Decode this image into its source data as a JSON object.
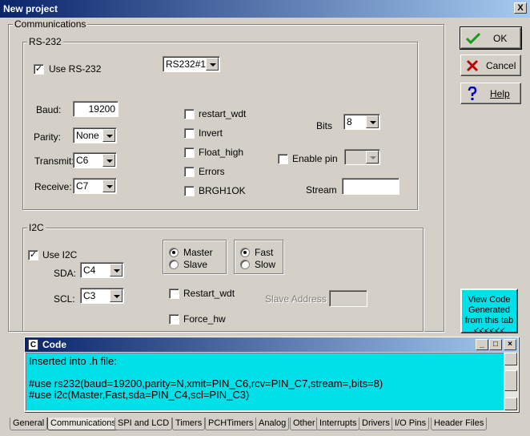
{
  "window": {
    "title": "New project",
    "close_glyph": "X"
  },
  "communications_group": {
    "label": "Communications"
  },
  "rs232": {
    "group_label": "RS-232",
    "use_label": "Use RS-232",
    "use_checked": true,
    "port_value": "RS232#1",
    "baud_label": "Baud:",
    "baud_value": "19200",
    "parity_label": "Parity:",
    "parity_value": "None",
    "transmit_label": "Transmit:",
    "transmit_value": "C6",
    "receive_label": "Receive:",
    "receive_value": "C7",
    "options": [
      {
        "label": "restart_wdt",
        "checked": false
      },
      {
        "label": "Invert",
        "checked": false
      },
      {
        "label": "Float_high",
        "checked": false
      },
      {
        "label": "Errors",
        "checked": false
      },
      {
        "label": "BRGH1OK",
        "checked": false
      }
    ],
    "bits_label": "Bits",
    "bits_value": "8",
    "enable_pin_label": "Enable pin",
    "enable_pin_checked": false,
    "enable_pin_value": "",
    "stream_label": "Stream",
    "stream_value": ""
  },
  "i2c": {
    "group_label": "I2C",
    "use_label": "Use I2C",
    "use_checked": true,
    "sda_label": "SDA:",
    "sda_value": "C4",
    "scl_label": "SCL:",
    "scl_value": "C3",
    "mode_options": [
      {
        "label": "Master",
        "selected": true
      },
      {
        "label": "Slave",
        "selected": false
      }
    ],
    "speed_options": [
      {
        "label": "Fast",
        "selected": true
      },
      {
        "label": "Slow",
        "selected": false
      }
    ],
    "restart_wdt_label": "Restart_wdt",
    "force_hw_label": "Force_hw",
    "slave_address_label": "Slave Address",
    "slave_address_value": ""
  },
  "buttons": {
    "ok": "OK",
    "cancel": "Cancel",
    "help": "Help"
  },
  "view_code": {
    "line1": "View Code",
    "line2": "Generated",
    "line3": "from this tab",
    "line4": "↙↙↙↙↙↙"
  },
  "code_window": {
    "title": "Code",
    "icon_glyph": "C",
    "lines": [
      "Inserted into .h file:",
      "",
      "#use rs232(baud=19200,parity=N,xmit=PIN_C6,rcv=PIN_C7,stream=,bits=8)",
      "#use i2c(Master,Fast,sda=PIN_C4,scl=PIN_C3)"
    ]
  },
  "tabs": [
    {
      "label": "General",
      "active": false
    },
    {
      "label": "Communications",
      "active": true
    },
    {
      "label": "SPI and LCD",
      "active": false
    },
    {
      "label": "Timers",
      "active": false
    },
    {
      "label": "PCHTimers",
      "active": false
    },
    {
      "label": "Analog",
      "active": false
    },
    {
      "label": "Other",
      "active": false
    },
    {
      "label": "Interrupts",
      "active": false
    },
    {
      "label": "Drivers",
      "active": false
    },
    {
      "label": "I/O Pins",
      "active": false
    },
    {
      "label": "Header Files",
      "active": false
    }
  ],
  "icons": {
    "ok": "checkmark-icon",
    "cancel": "cross-icon",
    "help": "question-icon",
    "code": "code-window-icon"
  },
  "colors": {
    "titlebar_start": "#0a246a",
    "titlebar_end": "#a6caf0",
    "face": "#d4d0c8",
    "code_bg": "#00e0e8",
    "ok_green": "#1a9a1a",
    "cancel_red": "#c00000",
    "help_blue": "#0000c0"
  }
}
